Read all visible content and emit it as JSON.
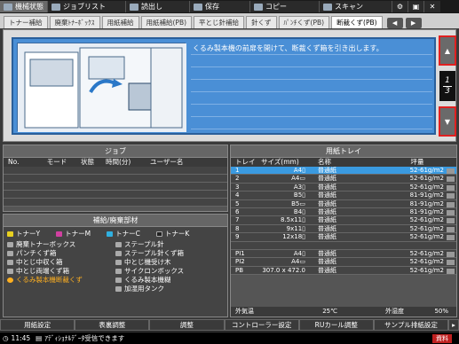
{
  "top_tabs": [
    {
      "label": "機械状態",
      "active": true
    },
    {
      "label": "ジョブリスト",
      "active": false
    },
    {
      "label": "読出し",
      "active": false
    },
    {
      "label": "保存",
      "active": false
    },
    {
      "label": "コピー",
      "active": false
    },
    {
      "label": "スキャン",
      "active": false
    }
  ],
  "sub_tabs": [
    {
      "label": "トナー補給"
    },
    {
      "label": "廃棄ﾄﾅｰﾎﾞｯｸｽ"
    },
    {
      "label": "用紙補給"
    },
    {
      "label": "用紙補給(PB)"
    },
    {
      "label": "平とじ針補給"
    },
    {
      "label": "針くず"
    },
    {
      "label": "ﾊﾟﾝﾁくず(PB)"
    },
    {
      "label": "断裁くず(PB)"
    }
  ],
  "nav": {
    "prev": "◀",
    "next": "▶"
  },
  "guide": {
    "text": "くるみ製本機の前扉を開けて、断裁くず箱を引き出します。",
    "page_current": "1",
    "page_total": "3",
    "up": "▲",
    "down": "▼"
  },
  "job": {
    "title": "ジョブ",
    "headers": [
      "No.",
      "モード",
      "状態",
      "時間(分)",
      "ユーザー名"
    ]
  },
  "supply": {
    "title": "補給/廃棄部材",
    "toner": [
      "トナーY",
      "トナーM",
      "トナーC",
      "トナーK"
    ],
    "items": [
      {
        "label": "廃棄トナーボックス",
        "warn": false
      },
      {
        "label": "ステープル針",
        "warn": false
      },
      {
        "label": "パンチくず箱",
        "warn": false
      },
      {
        "label": "ステープル針くず箱",
        "warn": false
      },
      {
        "label": "中とじ中収く箱",
        "warn": false
      },
      {
        "label": "中とじ機受け木",
        "warn": false
      },
      {
        "label": "中とじ両端くず箱",
        "warn": false
      },
      {
        "label": "サイクロンボックス",
        "warn": false
      },
      {
        "label": "くるみ製本機断裁くず",
        "warn": true
      },
      {
        "label": "くるみ製本機糊",
        "warn": false
      },
      {
        "label": "",
        "warn": false
      },
      {
        "label": "加湿用タンク",
        "warn": false
      }
    ]
  },
  "tray": {
    "title": "用紙トレイ",
    "headers": [
      "トレイ",
      "サイズ(mm)",
      "名称",
      "坪量"
    ],
    "rows": [
      {
        "tray": "1",
        "size": "A4▯",
        "name": "普通紙",
        "weight": "52-61g/m2",
        "sel": true
      },
      {
        "tray": "2",
        "size": "A4▭",
        "name": "普通紙",
        "weight": "52-61g/m2",
        "sel": false
      },
      {
        "tray": "3",
        "size": "A3▯",
        "name": "普通紙",
        "weight": "52-61g/m2",
        "sel": false
      },
      {
        "tray": "4",
        "size": "B5▯",
        "name": "普通紙",
        "weight": "81-91g/m2",
        "sel": false
      },
      {
        "tray": "5",
        "size": "B5▭",
        "name": "普通紙",
        "weight": "81-91g/m2",
        "sel": false
      },
      {
        "tray": "6",
        "size": "B4▯",
        "name": "普通紙",
        "weight": "81-91g/m2",
        "sel": false
      },
      {
        "tray": "7",
        "size": "8.5x11▯",
        "name": "普通紙",
        "weight": "52-61g/m2",
        "sel": false
      },
      {
        "tray": "8",
        "size": "9x11▯",
        "name": "普通紙",
        "weight": "52-61g/m2",
        "sel": false
      },
      {
        "tray": "9",
        "size": "12x18▯",
        "name": "普通紙",
        "weight": "52-61g/m2",
        "sel": false
      },
      {
        "tray": "",
        "size": "",
        "name": "",
        "weight": "",
        "sel": false
      },
      {
        "tray": "PI1",
        "size": "A4▯",
        "name": "普通紙",
        "weight": "52-61g/m2",
        "sel": false
      },
      {
        "tray": "PI2",
        "size": "A4▭",
        "name": "普通紙",
        "weight": "52-61g/m2",
        "sel": false
      },
      {
        "tray": "PB",
        "size": "307.0 x 472.0",
        "name": "普通紙",
        "weight": "52-61g/m2",
        "sel": false
      }
    ],
    "outside_temp_label": "外気温",
    "outside_temp": "25℃",
    "outside_humidity_label": "外湿度",
    "outside_humidity": "50%"
  },
  "bottom_buttons": [
    "用紙設定",
    "表裏調整",
    "調整",
    "コントローラー設定",
    "RUカール調整",
    "サンプル排紙設定"
  ],
  "status": {
    "time": "11:45",
    "message": "ｱﾃﾞｨｼｮﾅﾙﾃﾞｰﾀ受信できます",
    "badge": "資料"
  }
}
